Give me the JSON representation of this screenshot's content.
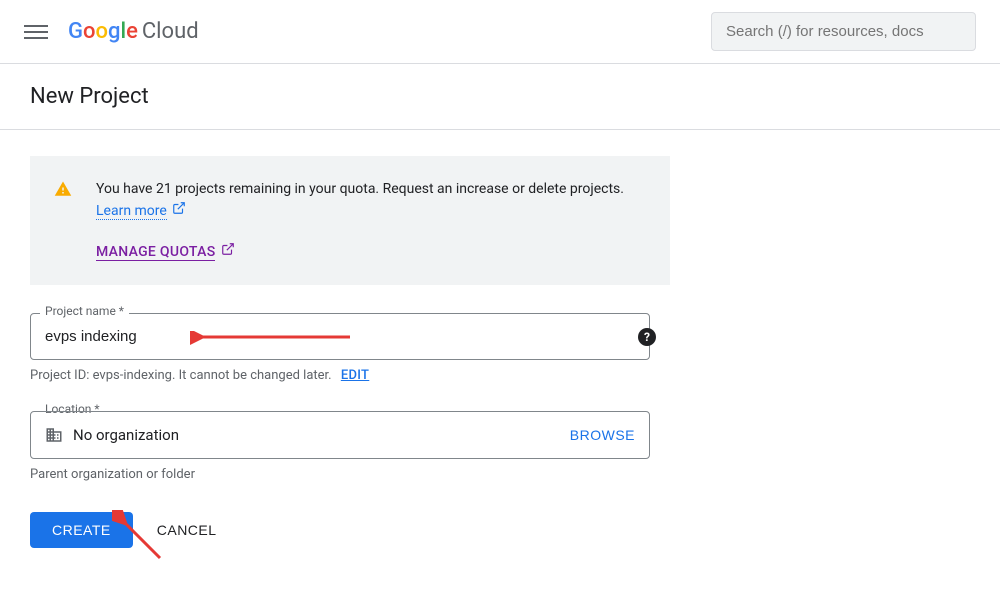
{
  "header": {
    "logo_cloud": "Cloud",
    "search_placeholder": "Search (/) for resources, docs"
  },
  "page": {
    "title": "New Project"
  },
  "banner": {
    "text1": "You have 21 projects remaining in your quota. Request an increase or delete projects.",
    "learn_more": "Learn more",
    "manage_quotas": "MANAGE QUOTAS"
  },
  "form": {
    "project_name_label": "Project name *",
    "project_name_value": "evps indexing",
    "project_id_text": "Project ID: evps-indexing. It cannot be changed later.",
    "edit_label": "EDIT",
    "location_label": "Location *",
    "location_value": "No organization",
    "browse_label": "BROWSE",
    "location_helper": "Parent organization or folder"
  },
  "buttons": {
    "create": "CREATE",
    "cancel": "CANCEL"
  }
}
